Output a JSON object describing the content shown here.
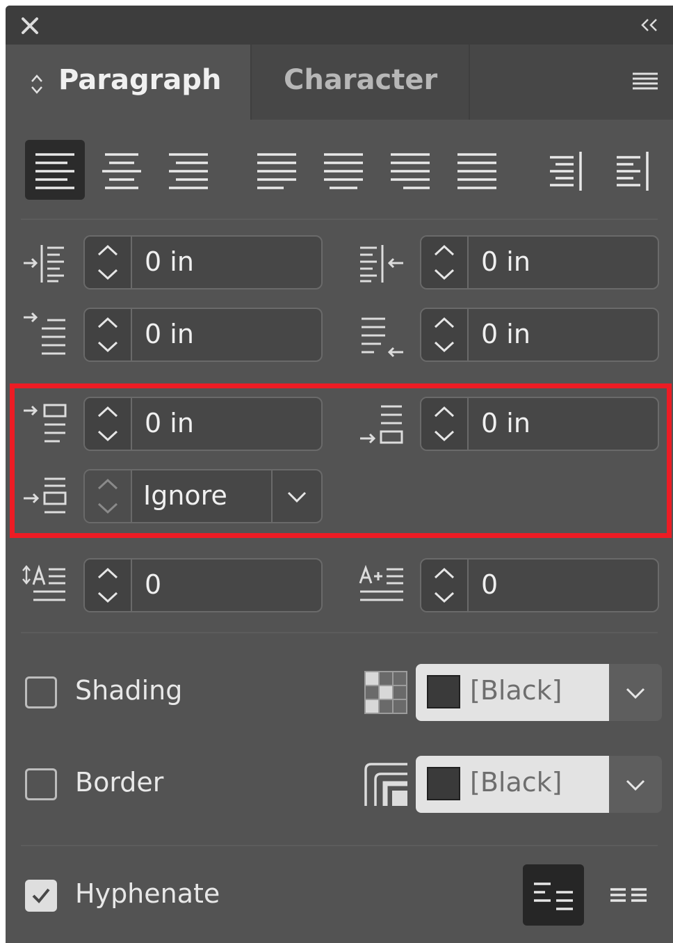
{
  "panel": {
    "close_icon": "close-icon",
    "collapse_icon": "collapse-double-chevron-icon"
  },
  "tabs": {
    "paragraph_label": "Paragraph",
    "character_label": "Character",
    "active": "Paragraph"
  },
  "alignment": {
    "buttons": [
      "align-left",
      "align-center",
      "align-right",
      "justify-last-left",
      "justify-last-center",
      "justify-last-right",
      "justify-all",
      "align-toward-spine",
      "align-away-from-spine"
    ],
    "selected": "align-left"
  },
  "indents": {
    "left_indent": "0 in",
    "right_indent": "0 in",
    "first_line_indent": "0 in",
    "last_line_indent": "0 in"
  },
  "spacing": {
    "space_before": "0 in",
    "space_after": "0 in",
    "space_between": "Ignore"
  },
  "dropcap": {
    "lines": "0",
    "characters": "0"
  },
  "shading": {
    "label": "Shading",
    "checked": false,
    "color": "[Black]"
  },
  "border": {
    "label": "Border",
    "checked": false,
    "color": "[Black]"
  },
  "hyphenate": {
    "label": "Hyphenate",
    "checked": true
  },
  "colors": {
    "panel_bg": "#535353",
    "highlight": "#ed1c24"
  }
}
